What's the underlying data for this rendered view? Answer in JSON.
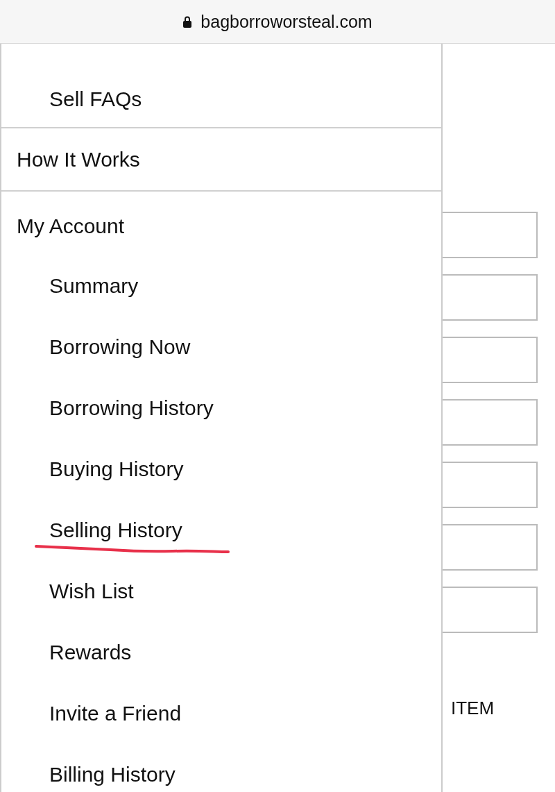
{
  "address_bar": {
    "url": "bagborroworsteal.com"
  },
  "menu": {
    "items": [
      {
        "kind": "sub",
        "label": "Sell FAQs",
        "annotated": false
      },
      {
        "kind": "section",
        "label": "How It Works",
        "annotated": false
      },
      {
        "kind": "section",
        "label": "My Account",
        "annotated": false
      },
      {
        "kind": "sub",
        "label": "Summary",
        "annotated": false
      },
      {
        "kind": "sub",
        "label": "Borrowing Now",
        "annotated": false
      },
      {
        "kind": "sub",
        "label": "Borrowing History",
        "annotated": false
      },
      {
        "kind": "sub",
        "label": "Buying History",
        "annotated": false
      },
      {
        "kind": "sub",
        "label": "Selling History",
        "annotated": true
      },
      {
        "kind": "sub",
        "label": "Wish List",
        "annotated": false
      },
      {
        "kind": "sub",
        "label": "Rewards",
        "annotated": false
      },
      {
        "kind": "sub",
        "label": "Invite a Friend",
        "annotated": false
      },
      {
        "kind": "sub",
        "label": "Billing History",
        "annotated": false
      }
    ]
  },
  "background_page": {
    "fields": [
      {
        "kind": "input"
      },
      {
        "kind": "input"
      },
      {
        "kind": "input"
      },
      {
        "kind": "input"
      },
      {
        "kind": "input"
      },
      {
        "kind": "input"
      },
      {
        "kind": "input"
      }
    ],
    "label": "ITEM"
  }
}
